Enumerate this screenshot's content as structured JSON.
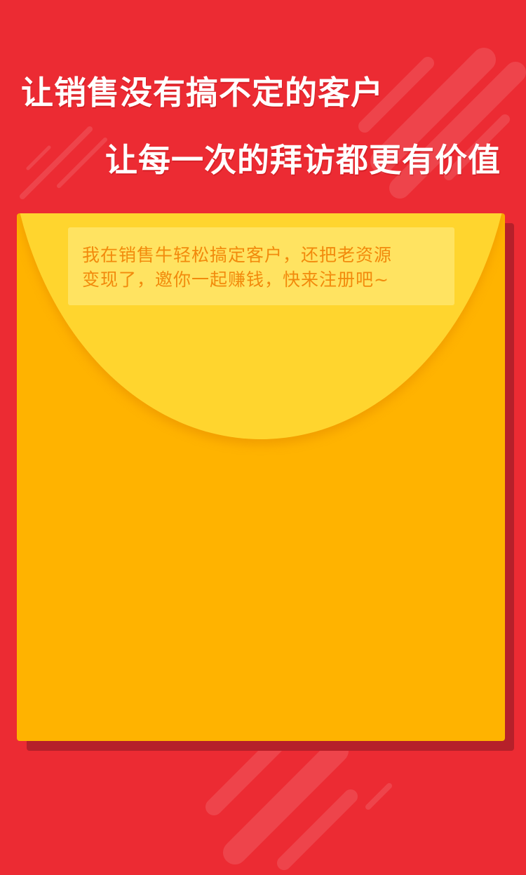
{
  "header": {
    "slogan_line1": "让销售没有搞不定的客户",
    "slogan_line2": "让每一次的拜访都更有价值"
  },
  "envelope": {
    "message_line1": "我在销售牛轻松搞定客户，还把老资源",
    "message_line2": "变现了，邀你一起赚钱，快来注册吧~"
  },
  "colors": {
    "background": "#ec2b33",
    "envelope_body": "#ffb300",
    "envelope_flap": "#ffd52e",
    "message_text": "#f28a0c"
  }
}
